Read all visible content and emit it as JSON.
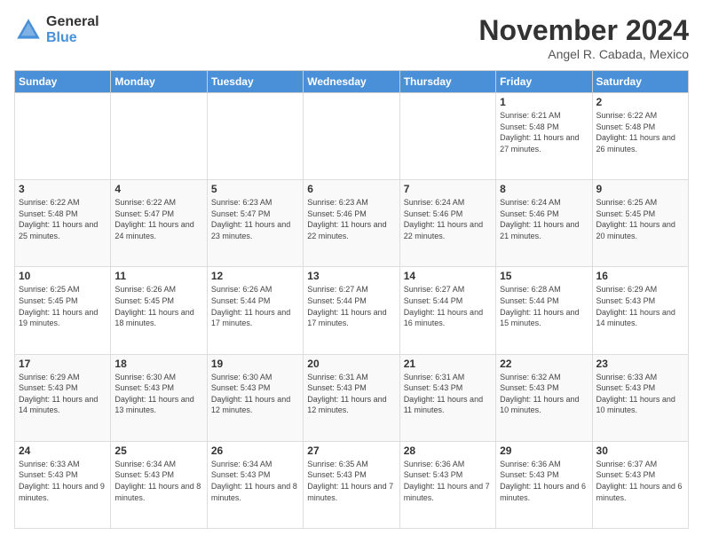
{
  "logo": {
    "general": "General",
    "blue": "Blue"
  },
  "header": {
    "month": "November 2024",
    "location": "Angel R. Cabada, Mexico"
  },
  "days_of_week": [
    "Sunday",
    "Monday",
    "Tuesday",
    "Wednesday",
    "Thursday",
    "Friday",
    "Saturday"
  ],
  "weeks": [
    [
      {
        "day": "",
        "info": ""
      },
      {
        "day": "",
        "info": ""
      },
      {
        "day": "",
        "info": ""
      },
      {
        "day": "",
        "info": ""
      },
      {
        "day": "",
        "info": ""
      },
      {
        "day": "1",
        "info": "Sunrise: 6:21 AM\nSunset: 5:48 PM\nDaylight: 11 hours and 27 minutes."
      },
      {
        "day": "2",
        "info": "Sunrise: 6:22 AM\nSunset: 5:48 PM\nDaylight: 11 hours and 26 minutes."
      }
    ],
    [
      {
        "day": "3",
        "info": "Sunrise: 6:22 AM\nSunset: 5:48 PM\nDaylight: 11 hours and 25 minutes."
      },
      {
        "day": "4",
        "info": "Sunrise: 6:22 AM\nSunset: 5:47 PM\nDaylight: 11 hours and 24 minutes."
      },
      {
        "day": "5",
        "info": "Sunrise: 6:23 AM\nSunset: 5:47 PM\nDaylight: 11 hours and 23 minutes."
      },
      {
        "day": "6",
        "info": "Sunrise: 6:23 AM\nSunset: 5:46 PM\nDaylight: 11 hours and 22 minutes."
      },
      {
        "day": "7",
        "info": "Sunrise: 6:24 AM\nSunset: 5:46 PM\nDaylight: 11 hours and 22 minutes."
      },
      {
        "day": "8",
        "info": "Sunrise: 6:24 AM\nSunset: 5:46 PM\nDaylight: 11 hours and 21 minutes."
      },
      {
        "day": "9",
        "info": "Sunrise: 6:25 AM\nSunset: 5:45 PM\nDaylight: 11 hours and 20 minutes."
      }
    ],
    [
      {
        "day": "10",
        "info": "Sunrise: 6:25 AM\nSunset: 5:45 PM\nDaylight: 11 hours and 19 minutes."
      },
      {
        "day": "11",
        "info": "Sunrise: 6:26 AM\nSunset: 5:45 PM\nDaylight: 11 hours and 18 minutes."
      },
      {
        "day": "12",
        "info": "Sunrise: 6:26 AM\nSunset: 5:44 PM\nDaylight: 11 hours and 17 minutes."
      },
      {
        "day": "13",
        "info": "Sunrise: 6:27 AM\nSunset: 5:44 PM\nDaylight: 11 hours and 17 minutes."
      },
      {
        "day": "14",
        "info": "Sunrise: 6:27 AM\nSunset: 5:44 PM\nDaylight: 11 hours and 16 minutes."
      },
      {
        "day": "15",
        "info": "Sunrise: 6:28 AM\nSunset: 5:44 PM\nDaylight: 11 hours and 15 minutes."
      },
      {
        "day": "16",
        "info": "Sunrise: 6:29 AM\nSunset: 5:43 PM\nDaylight: 11 hours and 14 minutes."
      }
    ],
    [
      {
        "day": "17",
        "info": "Sunrise: 6:29 AM\nSunset: 5:43 PM\nDaylight: 11 hours and 14 minutes."
      },
      {
        "day": "18",
        "info": "Sunrise: 6:30 AM\nSunset: 5:43 PM\nDaylight: 11 hours and 13 minutes."
      },
      {
        "day": "19",
        "info": "Sunrise: 6:30 AM\nSunset: 5:43 PM\nDaylight: 11 hours and 12 minutes."
      },
      {
        "day": "20",
        "info": "Sunrise: 6:31 AM\nSunset: 5:43 PM\nDaylight: 11 hours and 12 minutes."
      },
      {
        "day": "21",
        "info": "Sunrise: 6:31 AM\nSunset: 5:43 PM\nDaylight: 11 hours and 11 minutes."
      },
      {
        "day": "22",
        "info": "Sunrise: 6:32 AM\nSunset: 5:43 PM\nDaylight: 11 hours and 10 minutes."
      },
      {
        "day": "23",
        "info": "Sunrise: 6:33 AM\nSunset: 5:43 PM\nDaylight: 11 hours and 10 minutes."
      }
    ],
    [
      {
        "day": "24",
        "info": "Sunrise: 6:33 AM\nSunset: 5:43 PM\nDaylight: 11 hours and 9 minutes."
      },
      {
        "day": "25",
        "info": "Sunrise: 6:34 AM\nSunset: 5:43 PM\nDaylight: 11 hours and 8 minutes."
      },
      {
        "day": "26",
        "info": "Sunrise: 6:34 AM\nSunset: 5:43 PM\nDaylight: 11 hours and 8 minutes."
      },
      {
        "day": "27",
        "info": "Sunrise: 6:35 AM\nSunset: 5:43 PM\nDaylight: 11 hours and 7 minutes."
      },
      {
        "day": "28",
        "info": "Sunrise: 6:36 AM\nSunset: 5:43 PM\nDaylight: 11 hours and 7 minutes."
      },
      {
        "day": "29",
        "info": "Sunrise: 6:36 AM\nSunset: 5:43 PM\nDaylight: 11 hours and 6 minutes."
      },
      {
        "day": "30",
        "info": "Sunrise: 6:37 AM\nSunset: 5:43 PM\nDaylight: 11 hours and 6 minutes."
      }
    ]
  ]
}
